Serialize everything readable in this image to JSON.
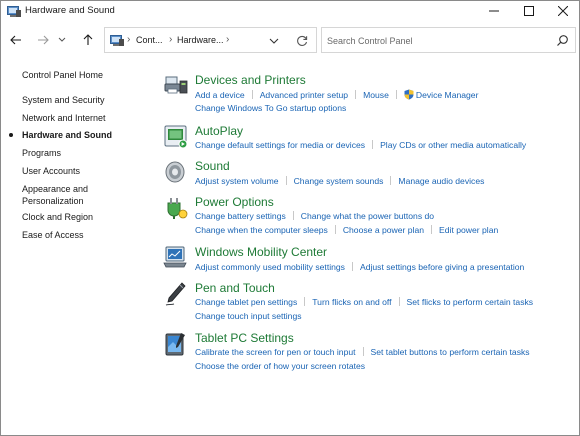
{
  "window": {
    "title": "Hardware and Sound"
  },
  "addressbar": {
    "crumbs": [
      "Cont...",
      "Hardware..."
    ]
  },
  "search": {
    "placeholder": "Search Control Panel"
  },
  "leftnav": {
    "items": [
      {
        "label": "Control Panel Home"
      },
      {
        "label": "System and Security"
      },
      {
        "label": "Network and Internet"
      },
      {
        "label": "Hardware and Sound",
        "active": true
      },
      {
        "label": "Programs"
      },
      {
        "label": "User Accounts"
      },
      {
        "label": "Appearance and"
      },
      {
        "label": "Personalization"
      },
      {
        "label": "Clock and Region"
      },
      {
        "label": "Ease of Access"
      }
    ]
  },
  "categories": [
    {
      "title": "Devices and Printers",
      "icon": "printer-icon",
      "lines": [
        [
          "Add a device",
          "Advanced printer setup",
          "Mouse",
          "Device Manager"
        ],
        [
          "Change Windows To Go startup options"
        ]
      ]
    },
    {
      "title": "AutoPlay",
      "icon": "autoplay-icon",
      "lines": [
        [
          "Change default settings for media or devices",
          "Play CDs or other media automatically"
        ]
      ]
    },
    {
      "title": "Sound",
      "icon": "speaker-icon",
      "lines": [
        [
          "Adjust system volume",
          "Change system sounds",
          "Manage audio devices"
        ]
      ]
    },
    {
      "title": "Power Options",
      "icon": "power-icon",
      "lines": [
        [
          "Change battery settings",
          "Change what the power buttons do"
        ],
        [
          "Change when the computer sleeps",
          "Choose a power plan",
          "Edit power plan"
        ]
      ]
    },
    {
      "title": "Windows Mobility Center",
      "icon": "mobility-icon",
      "lines": [
        [
          "Adjust commonly used mobility settings",
          "Adjust settings before giving a presentation"
        ]
      ]
    },
    {
      "title": "Pen and Touch",
      "icon": "pen-icon",
      "lines": [
        [
          "Change tablet pen settings",
          "Turn flicks on and off",
          "Set flicks to perform certain tasks"
        ],
        [
          "Change touch input settings"
        ]
      ]
    },
    {
      "title": "Tablet PC Settings",
      "icon": "tablet-icon",
      "lines": [
        [
          "Calibrate the screen for pen or touch input",
          "Set tablet buttons to perform certain tasks"
        ],
        [
          "Choose the order of how your screen rotates"
        ]
      ]
    }
  ],
  "colors": {
    "category_title": "#1e7a36",
    "task_link": "#1a64b4"
  }
}
